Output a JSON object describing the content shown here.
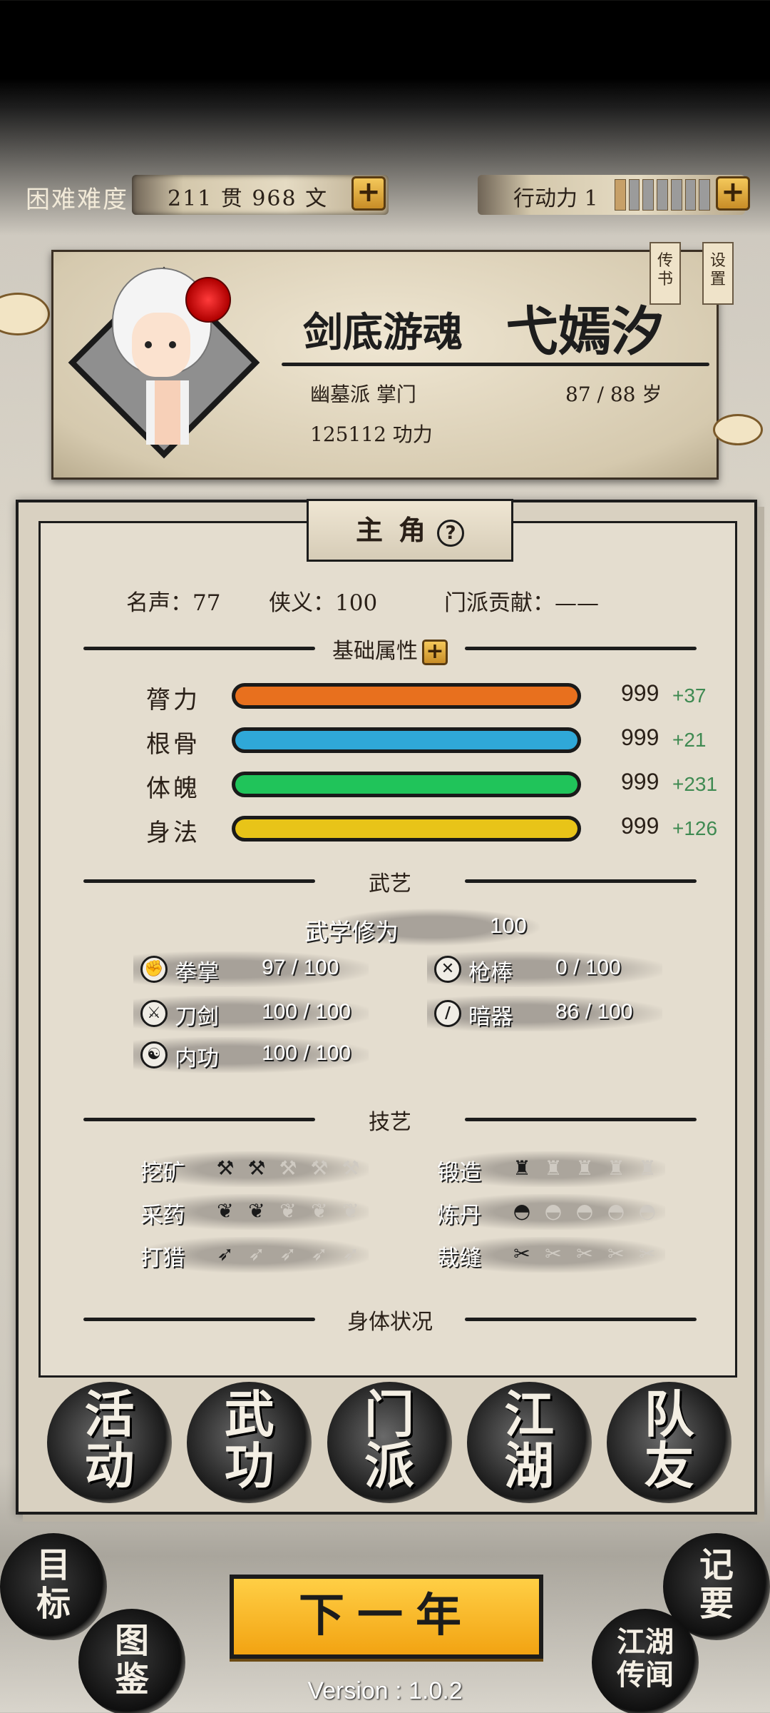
{
  "topbar": {
    "difficulty": "困难难度",
    "money": "211 贯 968 文",
    "money_add": "+",
    "energy_label": "行动力 1",
    "energy_filled": 1,
    "energy_total": 7,
    "energy_add": "+"
  },
  "character": {
    "title": "剑底游魂",
    "name": "弋嫣汐",
    "sect": "幽墓派 掌门",
    "age": "87 / 88 岁",
    "power": "125112 功力",
    "tag_book": "传书",
    "tag_settings": "设置"
  },
  "panel": {
    "tab_label": "主角",
    "help": "?",
    "fame": "名声：77",
    "chivalry": "侠义：100",
    "contribution": "门派贡献：——"
  },
  "attributes": {
    "header": "基础属性",
    "add": "+",
    "items": [
      {
        "name": "膂力",
        "value": "999",
        "bonus": "+37",
        "color": "#e8701e"
      },
      {
        "name": "根骨",
        "value": "999",
        "bonus": "+21",
        "color": "#2fa8d8"
      },
      {
        "name": "体魄",
        "value": "999",
        "bonus": "+231",
        "color": "#20c45a"
      },
      {
        "name": "身法",
        "value": "999",
        "bonus": "+126",
        "color": "#e8c418"
      }
    ]
  },
  "martial": {
    "header": "武艺",
    "cultivation_label": "武学修为",
    "cultivation_value": "100",
    "skills": [
      {
        "name": "拳掌",
        "value": "97 / 100",
        "icon": "fist-icon"
      },
      {
        "name": "枪棒",
        "value": "0 / 100",
        "icon": "spear-icon"
      },
      {
        "name": "刀剑",
        "value": "100 / 100",
        "icon": "sword-icon"
      },
      {
        "name": "暗器",
        "value": "86 / 100",
        "icon": "dart-icon"
      },
      {
        "name": "内功",
        "value": "100 / 100",
        "icon": "inner-power-icon"
      }
    ]
  },
  "crafts": {
    "header": "技艺",
    "items": [
      {
        "name": "挖矿",
        "level": 2,
        "max": 5,
        "icon": "pickaxe-icon"
      },
      {
        "name": "锻造",
        "level": 1,
        "max": 5,
        "icon": "anvil-icon"
      },
      {
        "name": "采药",
        "level": 2,
        "max": 5,
        "icon": "herb-icon"
      },
      {
        "name": "炼丹",
        "level": 1,
        "max": 5,
        "icon": "mortar-icon"
      },
      {
        "name": "打猎",
        "level": 1,
        "max": 5,
        "icon": "bow-icon"
      },
      {
        "name": "裁缝",
        "level": 1,
        "max": 5,
        "icon": "needle-icon"
      }
    ]
  },
  "body": {
    "header": "身体状况"
  },
  "nav": {
    "activity": "活动",
    "kungfu": "武功",
    "sect": "门派",
    "jianghu": "江湖",
    "team": "队友"
  },
  "bottom": {
    "goal": "目标",
    "atlas": "图鉴",
    "notes": "记要",
    "rumors": "江湖传闻",
    "next_year": "下一年",
    "version": "Version : 1.0.2"
  }
}
